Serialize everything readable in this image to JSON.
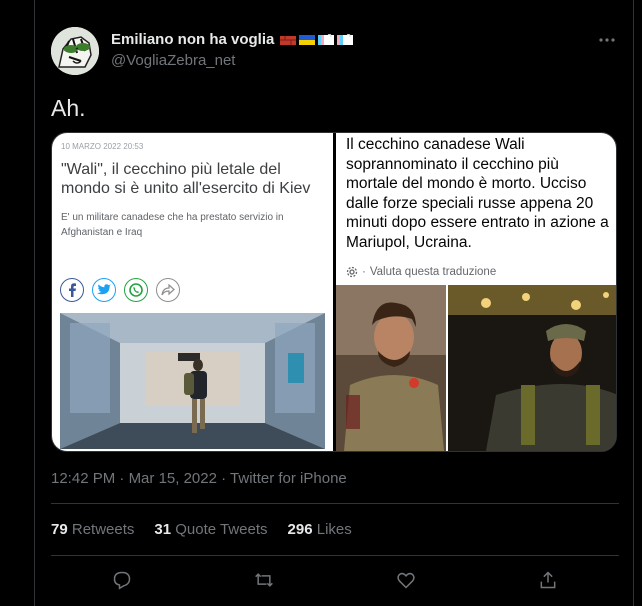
{
  "user": {
    "display_name": "Emiliano non ha voglia",
    "handle": "@VogliaZebra_net"
  },
  "tweet": {
    "text": "Ah."
  },
  "media": {
    "left": {
      "date": "10 MARZO 2022  20:53",
      "title": "\"Wali\", il cecchino più letale del mondo si è unito all'esercito di Kiev",
      "subtitle": "E' un militare canadese che ha prestato servizio in Afghanistan e Iraq"
    },
    "right": {
      "text": "Il cecchino canadese Wali soprannominato il cecchino più mortale del mondo è morto. Ucciso dalle forze speciali russe appena 20 minuti dopo essere entrato in azione a Mariupol, Ucraina.",
      "translate_label": "Valuta questa traduzione"
    }
  },
  "meta": {
    "time": "12:42 PM",
    "date": "Mar 15, 2022",
    "source": "Twitter for iPhone"
  },
  "stats": {
    "retweets": "79",
    "retweets_label": "Retweets",
    "quotes": "31",
    "quotes_label": "Quote Tweets",
    "likes": "296",
    "likes_label": "Likes"
  },
  "colors": {
    "background": "#000000",
    "text": "#e7e9ea",
    "muted": "#71767b",
    "border": "#2f3336"
  },
  "icons": [
    "more-icon",
    "reply-icon",
    "retweet-icon",
    "like-icon",
    "share-icon",
    "facebook-icon",
    "twitter-icon",
    "whatsapp-icon",
    "forward-icon",
    "gear-icon"
  ]
}
